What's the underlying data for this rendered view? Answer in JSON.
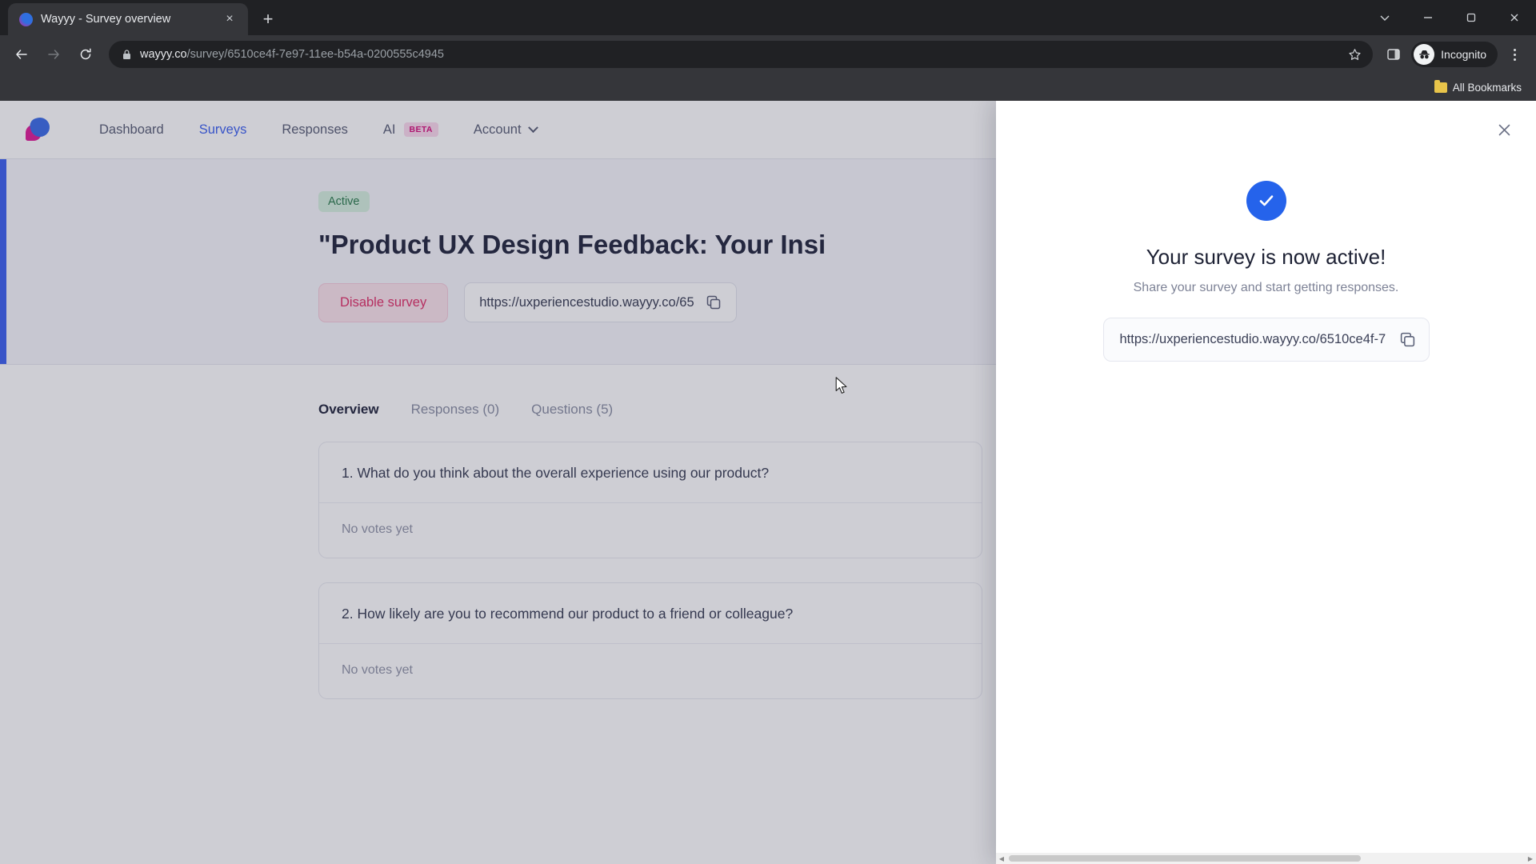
{
  "browser": {
    "tab": {
      "title": "Wayyy - Survey overview",
      "favicon_name": "wayyy-logo-icon",
      "close_label": "×"
    },
    "new_tab_label": "+",
    "window_controls": {
      "list_label": "⌄",
      "minimize_label": "–",
      "maximize_label": "❐",
      "close_label": "✕"
    },
    "toolbar": {
      "back_label": "←",
      "forward_label": "→",
      "reload_label": "↻",
      "url_host": "wayyy.co",
      "url_path": "/survey/6510ce4f-7e97-11ee-b54a-0200555c4945",
      "bookmark_label": "☆",
      "profile_label": "Incognito",
      "menu_label": "⋮"
    },
    "bookmarks": {
      "all_bookmarks_label": "All Bookmarks"
    }
  },
  "app": {
    "brand_name": "Wayyy",
    "nav": [
      {
        "label": "Dashboard",
        "active": false
      },
      {
        "label": "Surveys",
        "active": true
      },
      {
        "label": "Responses",
        "active": false
      },
      {
        "label": "AI",
        "active": false,
        "badge": "BETA"
      },
      {
        "label": "Account",
        "active": false,
        "has_chevron": true
      }
    ]
  },
  "survey": {
    "status": "Active",
    "title": "\"Product UX Design Feedback: Your Insi",
    "disable_button": "Disable survey",
    "share_url_short": "https://uxperiencestudio.wayyy.co/65",
    "tabs": [
      {
        "label": "Overview",
        "active": true
      },
      {
        "label": "Responses (0)",
        "active": false
      },
      {
        "label": "Questions (5)",
        "active": false
      }
    ],
    "questions": [
      {
        "text": "1. What do you think about the overall experience using our product?",
        "result": "No votes yet"
      },
      {
        "text": "2. How likely are you to recommend our product to a friend or colleague?",
        "result": "No votes yet"
      }
    ]
  },
  "drawer": {
    "close_label": "✕",
    "title": "Your survey is now active!",
    "subtitle": "Share your survey and start getting responses.",
    "share_url": "https://uxperiencestudio.wayyy.co/6510ce4f-7",
    "copy_icon_name": "copy-icon"
  },
  "colors": {
    "accent_blue": "#3f63f0",
    "success_blue": "#2563eb",
    "status_green": "#2e7d4f",
    "danger_pink": "#e0336b",
    "beta_pink": "#d6157f"
  }
}
